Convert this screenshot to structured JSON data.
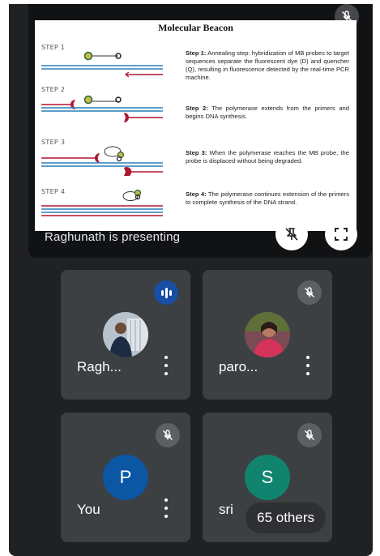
{
  "presentation": {
    "presenting_label": "Raghunath is presenting",
    "slide": {
      "title": "Molecular Beacon",
      "steps": [
        {
          "label": "STEP 1",
          "heading": "Step 1:",
          "text": "Annealing step: hybridization of MB probes to target sequences separate the fluorescent dye (D) and quencher (Q), resulting in fluorescence detected by the real-time PCR machine."
        },
        {
          "label": "STEP 2",
          "heading": "Step 2:",
          "text": "The polymerase extends from the primers and begins DNA synthesis."
        },
        {
          "label": "STEP 3",
          "heading": "Step 3:",
          "text": "When the polymerase reaches the MB probe, the probe is displaced without being degraded."
        },
        {
          "label": "STEP 4",
          "heading": "Step 4:",
          "text": "The polymerase continues extension of the primers to complete synthesis of the DNA strand."
        }
      ]
    },
    "buttons": {
      "unpin": "unpin-icon",
      "fullscreen": "fullscreen-icon"
    }
  },
  "participants": [
    {
      "name": "Ragh...",
      "avatar_type": "photo",
      "status": "speaking"
    },
    {
      "name": "paro...",
      "avatar_type": "photo",
      "status": "muted"
    },
    {
      "name": "You",
      "avatar_type": "letter",
      "letter": "P",
      "avatar_color": "#0b57a4",
      "status": "muted"
    },
    {
      "name": "sri",
      "avatar_type": "letter",
      "letter": "S",
      "avatar_color": "#10846f",
      "status": "muted"
    }
  ],
  "others_label": "65 others",
  "colors": {
    "background": "#202124",
    "tile": "#3c4043",
    "speaking": "#174ea6"
  }
}
